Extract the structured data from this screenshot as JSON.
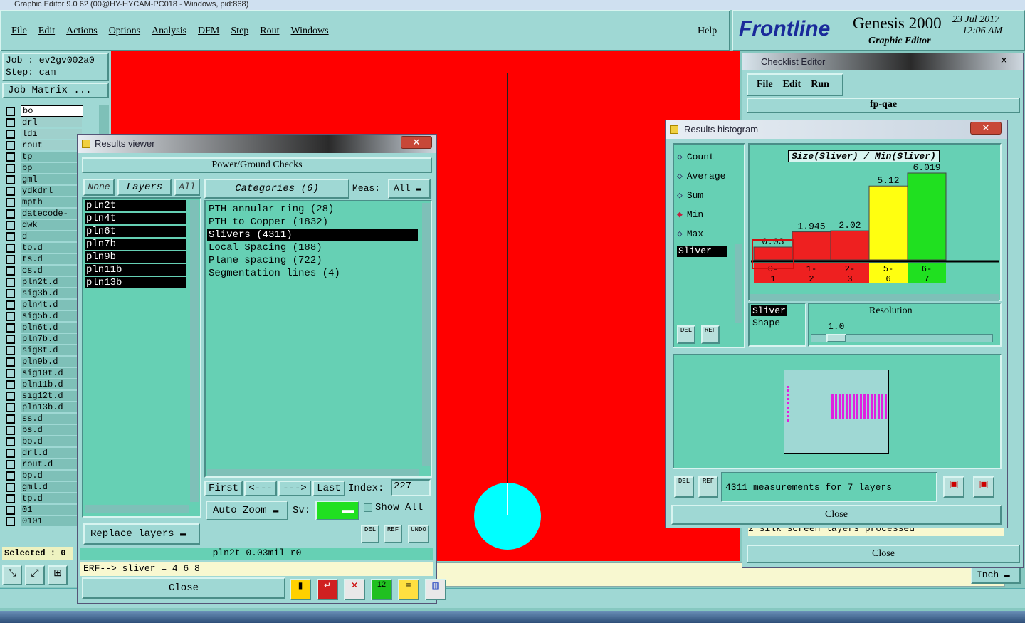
{
  "os_title": "Graphic Editor 9.0 62 (00@HY-HYCAM-PC018 - Windows, pid:868)",
  "menu": [
    "File",
    "Edit",
    "Actions",
    "Options",
    "Analysis",
    "DFM",
    "Step",
    "Rout",
    "Windows"
  ],
  "help": "Help",
  "brand": {
    "logo": "Frontline",
    "product": "Genesis 2000",
    "subtitle": "Graphic Editor",
    "date": "23 Jul 2017",
    "time": "12:06 AM"
  },
  "job": {
    "job": "Job : ev2gv002a0",
    "step": "Step: cam",
    "matrix": "Job Matrix ..."
  },
  "layers": [
    "bo",
    "drl",
    "ldi",
    "rout",
    "tp",
    "bp",
    "gml",
    "ydkdrl",
    "mpth",
    "datecode-",
    "dwk",
    "d",
    "to.d",
    "ts.d",
    "cs.d",
    "pln2t.d",
    "sig3b.d",
    "pln4t.d",
    "sig5b.d",
    "pln6t.d",
    "pln7b.d",
    "sig8t.d",
    "pln9b.d",
    "sig10t.d",
    "pln11b.d",
    "sig12t.d",
    "pln13b.d",
    "ss.d",
    "bs.d",
    "bo.d",
    "drl.d",
    "rout.d",
    "bp.d",
    "gml.d",
    "tp.d",
    "01",
    "0101"
  ],
  "selected": "Selected : 0",
  "units": "Inch",
  "results_viewer": {
    "title": "Results viewer",
    "header": "Power/Ground Checks",
    "none": "None",
    "layers": "Layers",
    "all": "All",
    "layer_list": [
      "pln2t",
      "pln4t",
      "pln6t",
      "pln7b",
      "pln9b",
      "pln11b",
      "pln13b"
    ],
    "categories_label": "Categories (6)",
    "meas_label": "Meas:",
    "meas_value": "All",
    "categories": [
      "PTH annular ring (28)",
      "PTH to Copper (1832)",
      "Slivers (4311)",
      "Local Spacing (188)",
      "Plane spacing (722)",
      "Segmentation lines (4)"
    ],
    "selected_category": 2,
    "first": "First",
    "prev": "<---",
    "next": "--->",
    "last": "Last",
    "index_label": "Index:",
    "index_value": "227",
    "auto_zoom": "Auto Zoom",
    "sv": "Sv:",
    "show_all": "Show All",
    "replace_layers": "Replace layers",
    "del": "DEL",
    "ref": "REF",
    "undo": "UNDO",
    "status": "pln2t 0.03mil  r0",
    "erf": "ERF--> sliver = 4 6 8",
    "close": "Close"
  },
  "checklist": {
    "title": "Checklist Editor",
    "menu": [
      "File",
      "Edit",
      "Run"
    ],
    "name": "fp-qae",
    "partial": "2 silk screen layers processed",
    "close": "Close"
  },
  "histogram": {
    "title": "Results histogram",
    "options": [
      "Count",
      "Average",
      "Sum",
      "Min",
      "Max"
    ],
    "selected_option": "Min",
    "measure_item": "Sliver",
    "chart_title": "Size(Sliver) / Min(Sliver)",
    "resolution_label": "Resolution",
    "resolution_value": "1.0",
    "shape_list": [
      "Sliver",
      "Shape"
    ],
    "summary": "4311 measurements for 7 layers",
    "close": "Close",
    "del": "DEL",
    "ref": "REF",
    "colors": {
      "red": "#ee2020",
      "yellow": "#ffff10",
      "green": "#20e020"
    }
  },
  "chart_data": {
    "type": "bar",
    "title": "Size(Sliver) / Min(Sliver)",
    "categories": [
      "0-1",
      "1-2",
      "2-3",
      "5-6",
      "6-7"
    ],
    "values": [
      0.03,
      1.945,
      2.02,
      5.12,
      6.019
    ],
    "labels": [
      "0.03",
      "1.945",
      "2.02",
      "5.12",
      "6.019"
    ],
    "colors": [
      "#ee2020",
      "#ee2020",
      "#ee2020",
      "#ffff10",
      "#20e020"
    ],
    "ylim": [
      0,
      6.019
    ]
  }
}
